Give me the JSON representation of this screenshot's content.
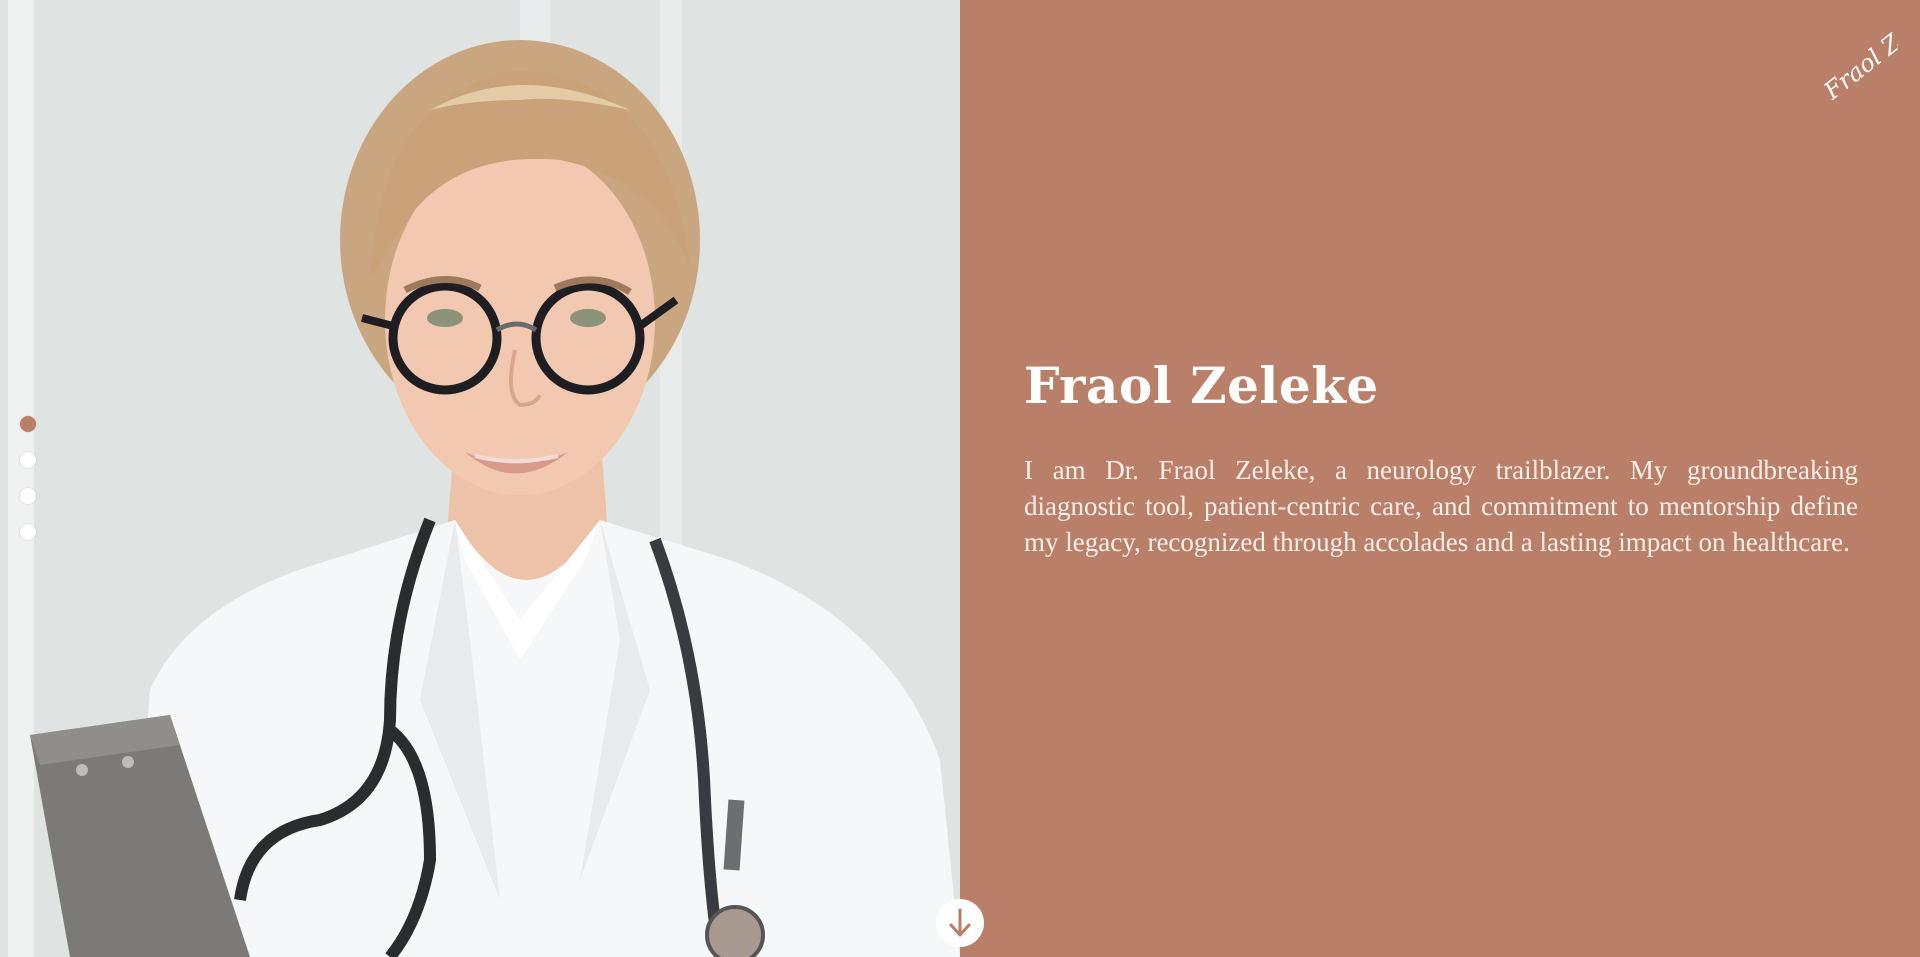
{
  "hero": {
    "name": "Fraol Zeleke",
    "bio": "I am Dr. Fraol Zeleke, a neurology trailblazer. My groundbreaking diagnostic tool, patient-centric care, and commitment to mentorship define my legacy, recognized through accolades and a lasting impact on healthcare.",
    "signature": "Fraol Z."
  },
  "slider": {
    "count": 4,
    "active_index": 0
  },
  "scroll_button": {
    "icon": "arrow-down-icon"
  },
  "colors": {
    "accent": "#b97f69",
    "text": "#ffffff",
    "dot_inactive": "#ffffff"
  }
}
